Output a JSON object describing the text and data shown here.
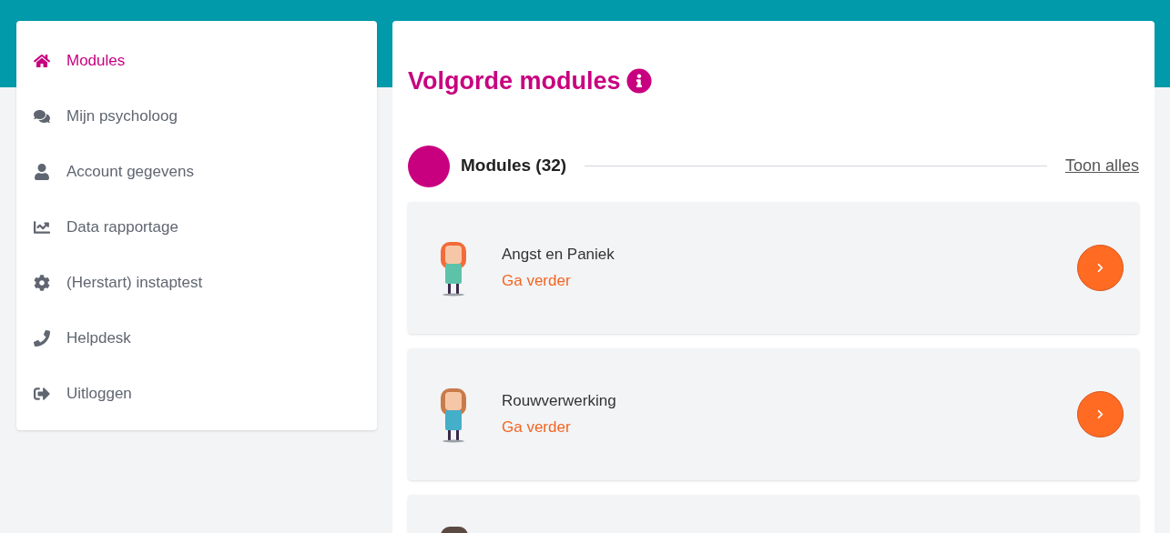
{
  "sidebar": {
    "items": [
      {
        "label": "Modules",
        "selected": true
      },
      {
        "label": "Mijn psycholoog",
        "selected": false
      },
      {
        "label": "Account gegevens",
        "selected": false
      },
      {
        "label": "Data rapportage",
        "selected": false
      },
      {
        "label": "(Herstart) instaptest",
        "selected": false
      },
      {
        "label": "Helpdesk",
        "selected": false
      },
      {
        "label": "Uitloggen",
        "selected": false
      }
    ]
  },
  "main": {
    "title": "Volgorde modules",
    "section": {
      "title": "Modules (32)",
      "link": "Toon alles",
      "modules": [
        {
          "kind": "module",
          "title": "Angst en Paniek",
          "status": "Ga verder"
        },
        {
          "kind": "module",
          "title": "Rouwverwerking",
          "status": "Ga verder"
        },
        {
          "kind": "partial"
        }
      ]
    }
  }
}
